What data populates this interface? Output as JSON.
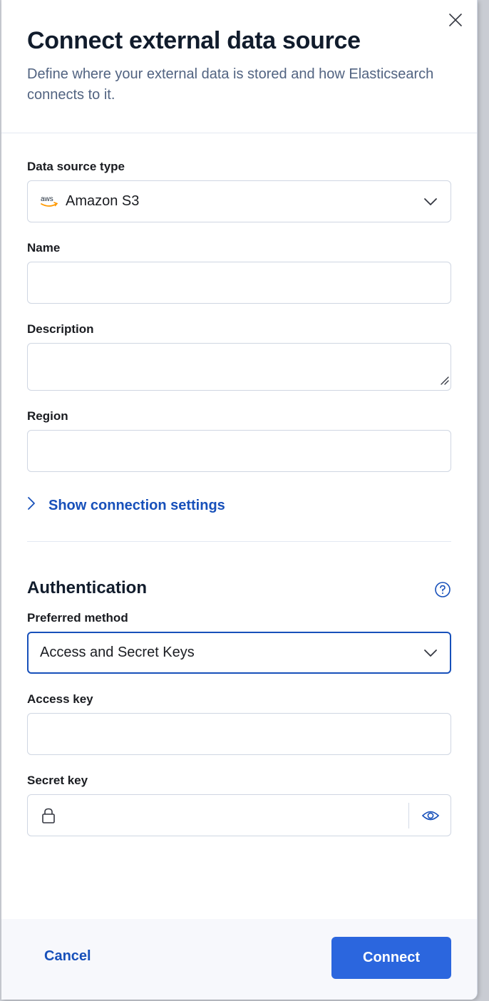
{
  "flyout": {
    "title": "Connect external data source",
    "subtitle": "Define where your external data is stored and how Elasticsearch connects to it."
  },
  "form": {
    "data_source_type": {
      "label": "Data source type",
      "value": "Amazon S3",
      "icon": "aws-logo",
      "logo_text": "aws"
    },
    "name": {
      "label": "Name",
      "value": ""
    },
    "description": {
      "label": "Description",
      "value": ""
    },
    "region": {
      "label": "Region",
      "value": ""
    },
    "show_connection_settings": "Show connection settings"
  },
  "authentication": {
    "title": "Authentication",
    "preferred_method": {
      "label": "Preferred method",
      "value": "Access and Secret Keys"
    },
    "access_key": {
      "label": "Access key",
      "value": ""
    },
    "secret_key": {
      "label": "Secret key",
      "value": ""
    }
  },
  "footer": {
    "cancel_label": "Cancel",
    "connect_label": "Connect"
  },
  "colors": {
    "primary": "#2b66de",
    "link": "#1750ba",
    "focus_border": "#1750ba",
    "aws_orange": "#f90"
  }
}
